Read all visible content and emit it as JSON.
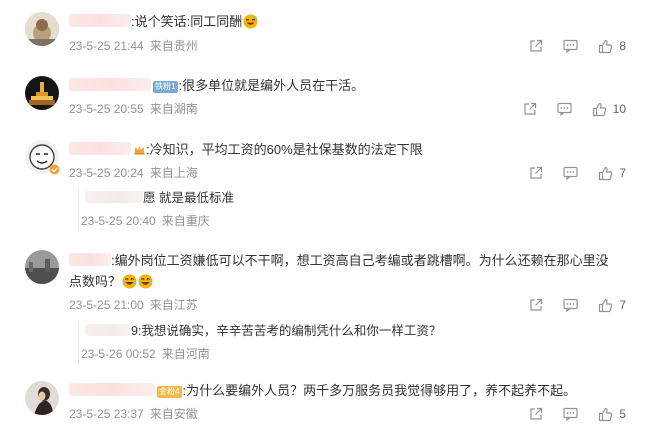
{
  "comments": [
    {
      "text": ":说个笑话:同工同酬",
      "date": "23-5-25 21:44",
      "location": "来自贵州",
      "likes": "8",
      "emoji_after": true
    },
    {
      "badge": "铁粉1",
      "text": ":很多单位就是编外人员在干活。",
      "date": "23-5-25 20:55",
      "location": "来自湖南",
      "likes": "10"
    },
    {
      "text": ":冷知识，平均工资的60%是社保基数的法定下限",
      "date": "23-5-25 20:24",
      "location": "来自上海",
      "likes": "7",
      "reply": {
        "text_suffix": "愿 就是最低标准",
        "date": "23-5-25 20:40",
        "location": "来自重庆"
      }
    },
    {
      "text": ":编外岗位工资嫌低可以不干啊，想工资高自己考编或者跳槽啊。为什么还赖在那心里没点数吗？",
      "date": "23-5-25 21:00",
      "location": "来自江苏",
      "likes": "7",
      "reply": {
        "text_suffix": "9:我想说确实，辛辛苦苦考的编制凭什么和你一样工资？",
        "date": "23-5-26 00:52",
        "location": "来自河南"
      }
    },
    {
      "badge": "金粉4",
      "text": ":为什么要编外人员？两千多万服务员我觉得够用了，养不起养不起。",
      "date": "23-5-25 23:37",
      "location": "来自安徽",
      "likes": "5"
    }
  ],
  "icons": {
    "share": "share-icon",
    "comment": "comment-icon",
    "like": "thumbs-up-icon"
  },
  "colors": {
    "meta_gray": "#939393",
    "text": "#333333",
    "blur_pink": "#fbe1de"
  }
}
